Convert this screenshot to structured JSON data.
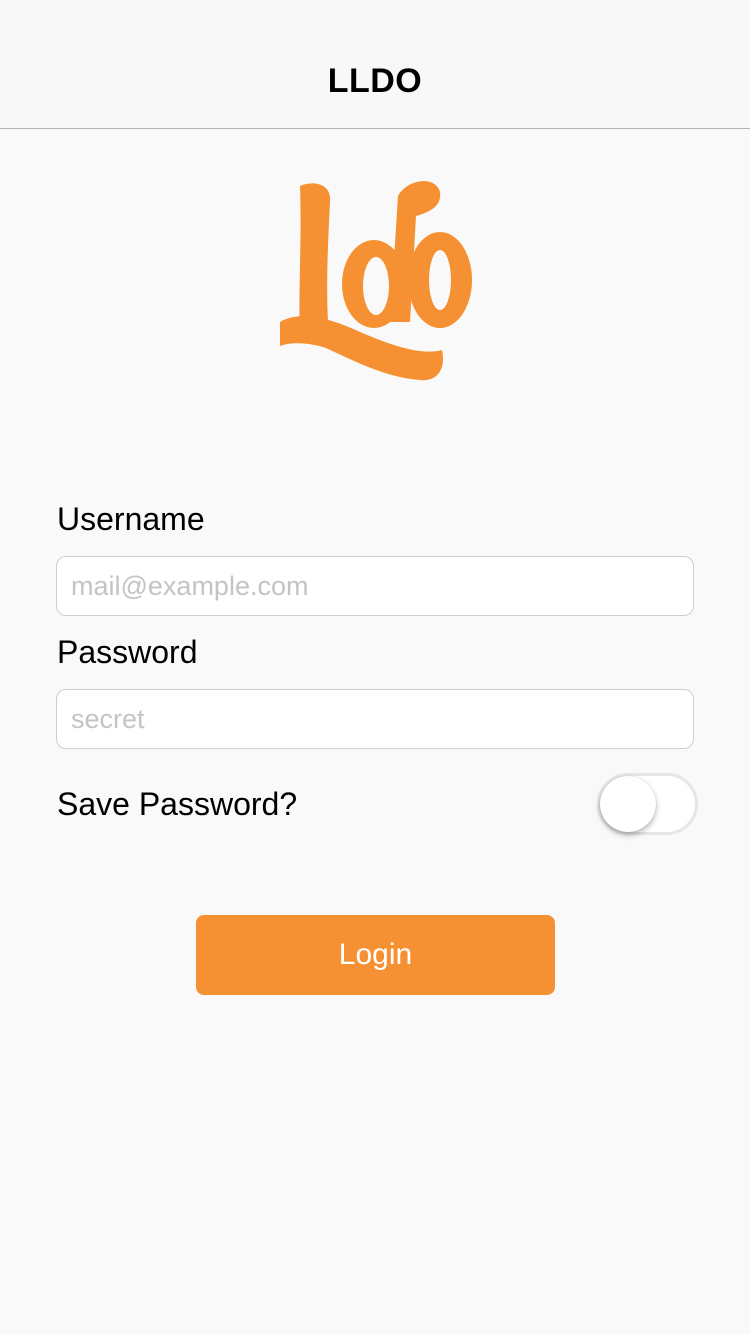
{
  "navbar": {
    "title": "LLDO"
  },
  "logo": {
    "text": "Ldo",
    "icon": "brand-logo",
    "color": "#f59133"
  },
  "form": {
    "username_label": "Username",
    "username_placeholder": "mail@example.com",
    "username_value": "",
    "password_label": "Password",
    "password_placeholder": "secret",
    "password_value": "",
    "save_password_label": "Save Password?",
    "save_password_on": false
  },
  "login_button_label": "Login",
  "colors": {
    "accent": "#f59133",
    "background": "#f9f9f9",
    "placeholder": "#c4c4c8"
  }
}
